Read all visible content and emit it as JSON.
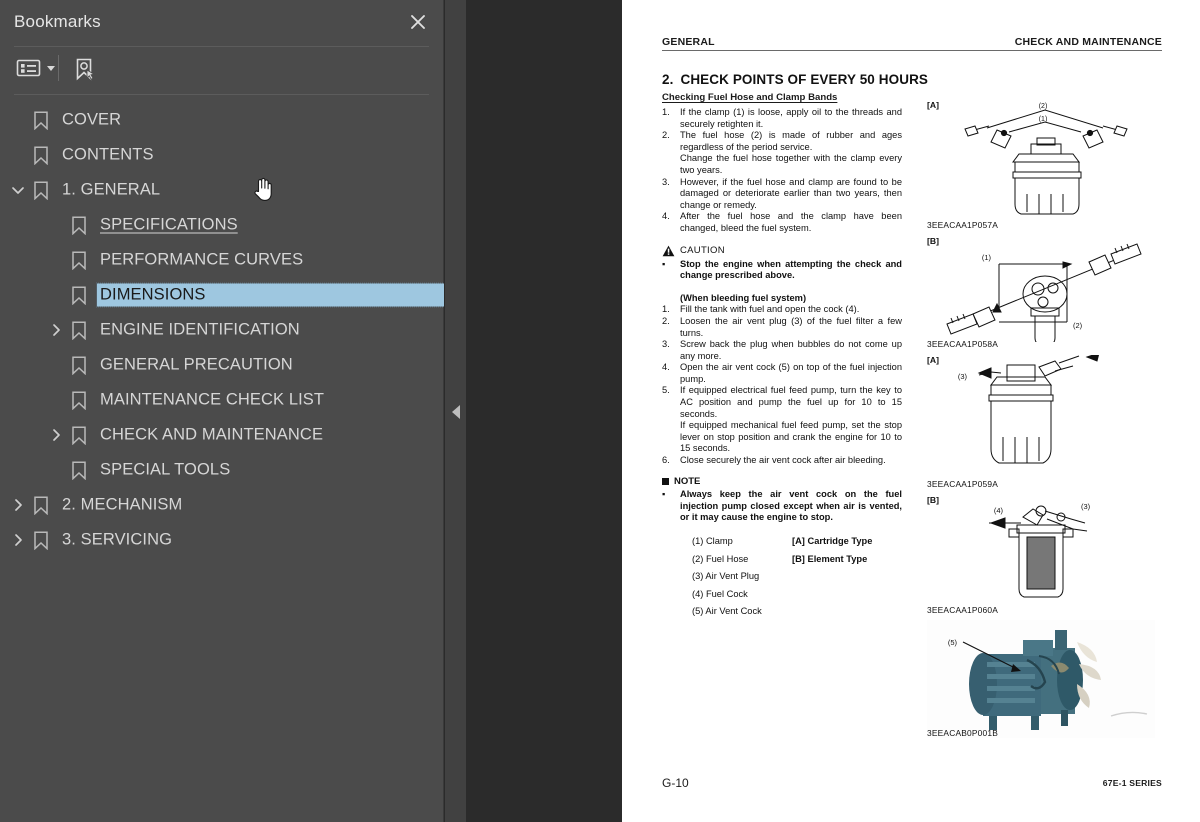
{
  "sidebar": {
    "title": "Bookmarks",
    "close_icon": "close-icon",
    "toolbar": {
      "options_icon": "list-options-icon",
      "new_bookmark_icon": "new-bookmark-icon"
    },
    "items": [
      {
        "label": "COVER",
        "level": 0,
        "twisty": "none",
        "state": "normal"
      },
      {
        "label": "CONTENTS",
        "level": 0,
        "twisty": "none",
        "state": "normal"
      },
      {
        "label": "1. GENERAL",
        "level": 0,
        "twisty": "expanded",
        "state": "normal"
      },
      {
        "label": "SPECIFICATIONS",
        "level": 1,
        "twisty": "none",
        "state": "underlined"
      },
      {
        "label": "PERFORMANCE CURVES",
        "level": 1,
        "twisty": "none",
        "state": "normal"
      },
      {
        "label": "DIMENSIONS",
        "level": 1,
        "twisty": "none",
        "state": "selected"
      },
      {
        "label": "ENGINE IDENTIFICATION",
        "level": 1,
        "twisty": "collapsed",
        "state": "normal"
      },
      {
        "label": "GENERAL PRECAUTION",
        "level": 1,
        "twisty": "none",
        "state": "normal"
      },
      {
        "label": "MAINTENANCE CHECK LIST",
        "level": 1,
        "twisty": "none",
        "state": "normal"
      },
      {
        "label": "CHECK AND MAINTENANCE",
        "level": 1,
        "twisty": "collapsed",
        "state": "normal"
      },
      {
        "label": "SPECIAL TOOLS",
        "level": 1,
        "twisty": "none",
        "state": "normal"
      },
      {
        "label": "2. MECHANISM",
        "level": 0,
        "twisty": "collapsed",
        "state": "normal"
      },
      {
        "label": "3. SERVICING",
        "level": 0,
        "twisty": "collapsed",
        "state": "normal"
      }
    ]
  },
  "viewer": {
    "collapse_handle_icon": "chevron-left-icon",
    "cursor_icon": "hand-pointer-cursor"
  },
  "page": {
    "header_left": "GENERAL",
    "header_right": "CHECK AND MAINTENANCE",
    "section_number": "2.",
    "section_title": "CHECK POINTS OF EVERY 50 HOURS",
    "subsection_title": "Checking Fuel Hose and Clamp Bands",
    "steps": [
      {
        "marker": "1.",
        "lines": [
          "If the clamp (1) is loose, apply oil to the threads and securely retighten it."
        ]
      },
      {
        "marker": "2.",
        "lines": [
          "The fuel hose (2) is made of rubber and ages regardless of the period service.",
          "Change the fuel hose together with the clamp every two years."
        ]
      },
      {
        "marker": "3.",
        "lines": [
          "However, if the fuel hose and clamp are found to be damaged or deteriorate earlier than two years, then change or remedy."
        ]
      },
      {
        "marker": "4.",
        "lines": [
          "After the fuel hose and the clamp have been changed, bleed the fuel system."
        ]
      }
    ],
    "caution": {
      "icon": "warning-triangle-icon",
      "label": "CAUTION",
      "bullet_marker": "▪",
      "text": "Stop the engine when attempting the check and change prescribed above."
    },
    "bleeding_heading": "(When bleeding fuel system)",
    "bleeding_steps": [
      {
        "marker": "1.",
        "lines": [
          "Fill the tank with fuel and open the cock (4)."
        ]
      },
      {
        "marker": "2.",
        "lines": [
          "Loosen the air vent plug (3) of the fuel filter a few turns."
        ]
      },
      {
        "marker": "3.",
        "lines": [
          "Screw back the plug when bubbles do not come up any more."
        ]
      },
      {
        "marker": "4.",
        "lines": [
          "Open the air vent cock (5) on top of the fuel injection pump."
        ]
      },
      {
        "marker": "5.",
        "lines": [
          "If equipped electrical fuel feed pump, turn the key to AC position and pump the fuel up for 10 to 15 seconds.",
          "If equipped mechanical fuel feed pump, set the stop lever on stop position and crank the engine for 10 to 15 seconds."
        ]
      },
      {
        "marker": "6.",
        "lines": [
          "Close securely the air vent cock after air bleeding."
        ]
      }
    ],
    "note": {
      "icon": "square-bullet-icon",
      "label": "NOTE",
      "bullet_marker": "▪",
      "text": "Always keep the air vent cock on the fuel injection pump closed except when air is vented, or it may cause the engine to stop."
    },
    "key_rows": [
      {
        "left": "(1) Clamp",
        "right": "[A] Cartridge Type"
      },
      {
        "left": "(2) Fuel Hose",
        "right": "[B] Element Type"
      },
      {
        "left": "(3) Air Vent Plug",
        "right": ""
      },
      {
        "left": "(4) Fuel Cock",
        "right": ""
      },
      {
        "left": "(5) Air Vent Cock",
        "right": ""
      }
    ],
    "figures": [
      {
        "tag": "[A]",
        "caption": "3EEACAA1P057A",
        "callouts": [
          "(2)",
          "(1)"
        ],
        "kind": "cartridge-filter-with-hoses"
      },
      {
        "tag": "[B]",
        "caption": "3EEACAA1P058A",
        "callouts": [
          "(1)",
          "(2)"
        ],
        "kind": "element-filter-with-hoses"
      },
      {
        "tag": "[A]",
        "caption": "3EEACAA1P059A",
        "callouts": [
          "(3)"
        ],
        "kind": "cartridge-filter-air-vent-plug"
      },
      {
        "tag": "[B]",
        "caption": "3EEACAA1P060A",
        "callouts": [
          "(4)",
          "(3)"
        ],
        "kind": "element-filter-cutaway"
      },
      {
        "tag": "",
        "caption": "3EEACAB0P001B",
        "callouts": [
          "(5)"
        ],
        "kind": "engine-photo"
      }
    ],
    "footer_left": "G-10",
    "footer_right": "67E-1 SERIES"
  },
  "colors": {
    "sidebar_bg": "#4b4b4b",
    "viewer_bg": "#2b2b2b",
    "selection_bg": "#9ec7e0",
    "page_bg": "#ffffff",
    "engine_photo": "#3f6a7c"
  }
}
